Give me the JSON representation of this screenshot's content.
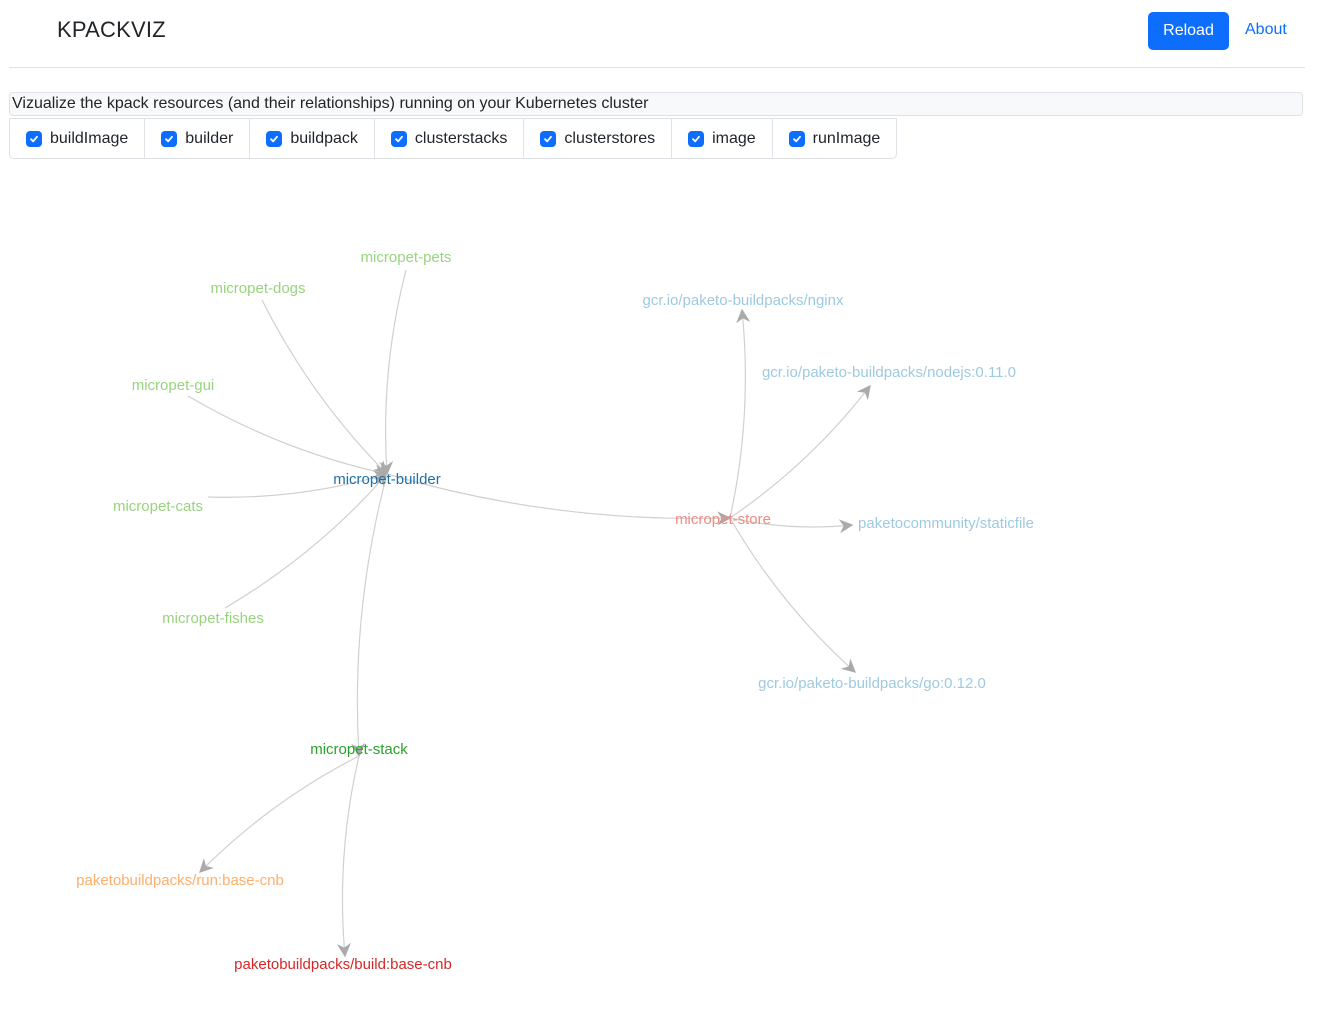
{
  "header": {
    "title": "KPACKVIZ",
    "reload_label": "Reload",
    "about_label": "About"
  },
  "description": "Vizualize the kpack resources (and their relationships) running on your Kubernetes cluster",
  "filters": [
    {
      "label": "buildImage",
      "checked": true
    },
    {
      "label": "builder",
      "checked": true
    },
    {
      "label": "buildpack",
      "checked": true
    },
    {
      "label": "clusterstacks",
      "checked": true
    },
    {
      "label": "clusterstores",
      "checked": true
    },
    {
      "label": "image",
      "checked": true
    },
    {
      "label": "runImage",
      "checked": true
    }
  ],
  "colors": {
    "accent": "#0d6efd",
    "image": "#98d47e",
    "builder": "#1f6fa8",
    "clusterstack": "#2ca02c",
    "clusterstore": "#f28b82",
    "buildpack": "#9ecae1",
    "runImage": "#fdae6b",
    "buildImage": "#d62728",
    "edge": "#d0d0d0",
    "arrow": "#aaaaaa"
  },
  "graph": {
    "nodes": [
      {
        "id": "micropet-pets",
        "label": "micropet-pets",
        "kind": "image"
      },
      {
        "id": "micropet-dogs",
        "label": "micropet-dogs",
        "kind": "image"
      },
      {
        "id": "micropet-gui",
        "label": "micropet-gui",
        "kind": "image"
      },
      {
        "id": "micropet-cats",
        "label": "micropet-cats",
        "kind": "image"
      },
      {
        "id": "micropet-fishes",
        "label": "micropet-fishes",
        "kind": "image"
      },
      {
        "id": "micropet-builder",
        "label": "micropet-builder",
        "kind": "builder"
      },
      {
        "id": "micropet-stack",
        "label": "micropet-stack",
        "kind": "clusterstack"
      },
      {
        "id": "run-base-cnb",
        "label": "paketobuildpacks/run:base-cnb",
        "kind": "runImage"
      },
      {
        "id": "build-base-cnb",
        "label": "paketobuildpacks/build:base-cnb",
        "kind": "buildImage"
      },
      {
        "id": "micropet-store",
        "label": "micropet-store",
        "kind": "clusterstore"
      },
      {
        "id": "nginx",
        "label": "gcr.io/paketo-buildpacks/nginx",
        "kind": "buildpack"
      },
      {
        "id": "nodejs",
        "label": "gcr.io/paketo-buildpacks/nodejs:0.11.0",
        "kind": "buildpack"
      },
      {
        "id": "staticfile",
        "label": "paketocommunity/staticfile",
        "kind": "buildpack"
      },
      {
        "id": "go",
        "label": "gcr.io/paketo-buildpacks/go:0.12.0",
        "kind": "buildpack"
      }
    ],
    "edges": [
      {
        "source": "micropet-pets",
        "target": "micropet-builder"
      },
      {
        "source": "micropet-dogs",
        "target": "micropet-builder"
      },
      {
        "source": "micropet-gui",
        "target": "micropet-builder"
      },
      {
        "source": "micropet-cats",
        "target": "micropet-builder"
      },
      {
        "source": "micropet-fishes",
        "target": "micropet-builder"
      },
      {
        "source": "micropet-builder",
        "target": "micropet-stack"
      },
      {
        "source": "micropet-builder",
        "target": "micropet-store"
      },
      {
        "source": "micropet-stack",
        "target": "run-base-cnb"
      },
      {
        "source": "micropet-stack",
        "target": "build-base-cnb"
      },
      {
        "source": "micropet-store",
        "target": "nginx"
      },
      {
        "source": "micropet-store",
        "target": "nodejs"
      },
      {
        "source": "micropet-store",
        "target": "staticfile"
      },
      {
        "source": "micropet-store",
        "target": "go"
      }
    ]
  }
}
